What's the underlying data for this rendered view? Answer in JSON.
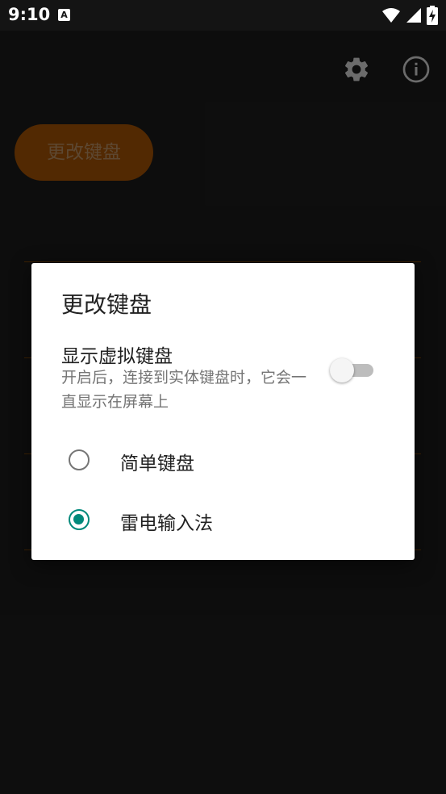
{
  "status_bar": {
    "time": "9:10",
    "notification_icon_letter": "A",
    "icons": [
      "wifi-icon",
      "signal-icon",
      "battery-charging-icon"
    ]
  },
  "toolbar": {
    "icons": [
      "settings-gear-icon",
      "info-icon"
    ],
    "icon_color": "#9e9e9e"
  },
  "main": {
    "change_keyboard_button": "更改键盘",
    "accent_color": "#7a3d03"
  },
  "dialog": {
    "title": "更改键盘",
    "show_virtual_keyboard": {
      "title": "显示虚拟键盘",
      "description": "开启后，连接到实体键盘时，它会一直显示在屏幕上",
      "enabled": false
    },
    "options": [
      {
        "label": "简单键盘",
        "selected": false
      },
      {
        "label": "雷电输入法",
        "selected": true
      }
    ],
    "radio_color": "#00897b"
  }
}
